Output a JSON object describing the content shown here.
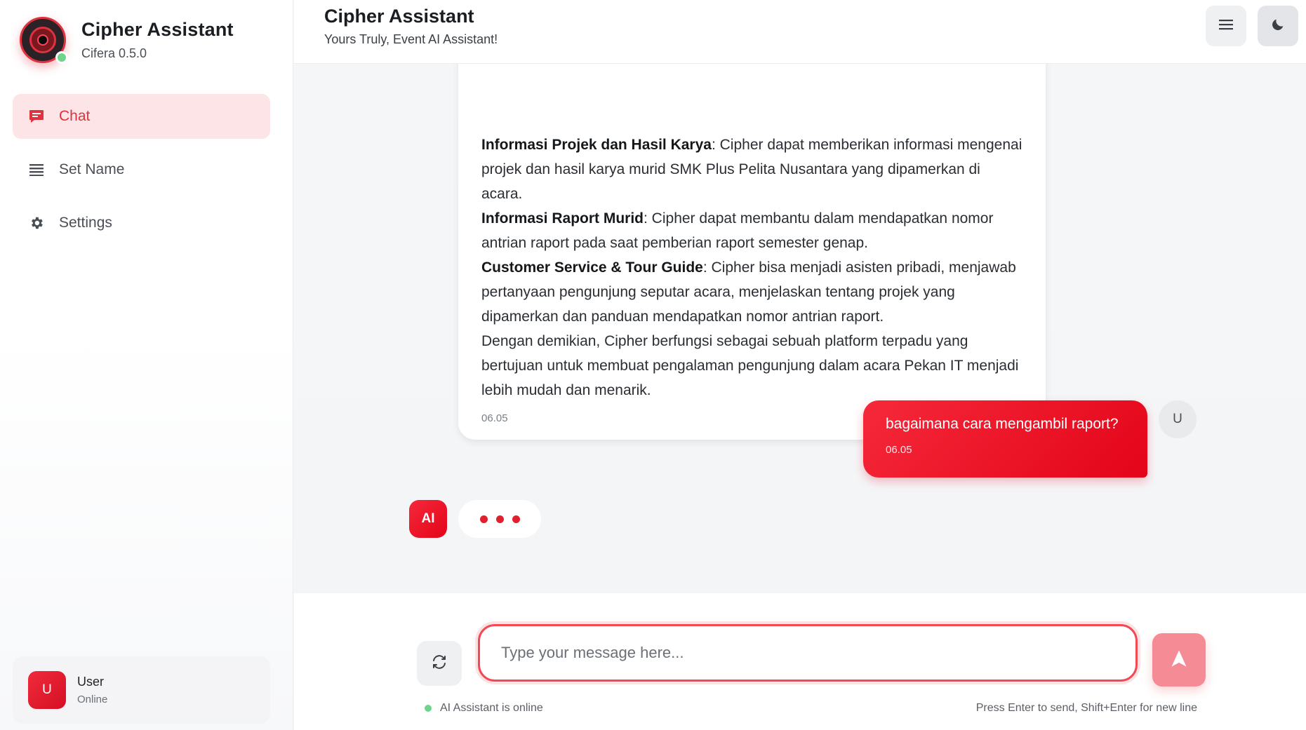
{
  "brand": {
    "title": "Cipher Assistant",
    "version": "Cifera 0.5.0"
  },
  "nav": [
    {
      "label": "Chat",
      "icon": "chat-icon",
      "active": true
    },
    {
      "label": "Set Name",
      "icon": "list-icon",
      "active": false
    },
    {
      "label": "Settings",
      "icon": "gear-icon",
      "active": false
    }
  ],
  "user": {
    "avatar": "U",
    "name": "User",
    "status": "Online"
  },
  "header": {
    "title": "Cipher Assistant",
    "subtitle": "Yours Truly, Event AI Assistant!",
    "menu_icon": "menu-icon",
    "theme_icon": "moon-icon"
  },
  "messages": {
    "ai_prev": {
      "p1_bold": "Informasi Projek dan Hasil Karya",
      "p1_text": ": Cipher dapat memberikan informasi mengenai projek dan hasil karya murid SMK Plus Pelita Nusantara yang dipamerkan di acara.",
      "p2_bold": "Informasi Raport Murid",
      "p2_text": ": Cipher dapat membantu dalam mendapatkan nomor antrian raport pada saat pemberian raport semester genap.",
      "p3_bold": "Customer Service & Tour Guide",
      "p3_text": ": Cipher bisa menjadi asisten pribadi, menjawab pertanyaan pengunjung seputar acara, menjelaskan tentang projek yang dipamerkan dan panduan mendapatkan nomor antrian raport.",
      "p4_text": "Dengan demikian, Cipher berfungsi sebagai sebuah platform terpadu yang bertujuan untuk membuat pengalaman pengunjung dalam acara Pekan IT menjadi lebih mudah dan menarik.",
      "time": "06.05"
    },
    "user_msg": {
      "text": "bagaimana cara mengambil raport?",
      "time": "06.05",
      "avatar": "U"
    },
    "ai_typing": {
      "avatar": "AI"
    }
  },
  "composer": {
    "placeholder": "Type your message here...",
    "value": "",
    "status": "AI Assistant is online",
    "hint": "Press Enter to send, Shift+Enter for new line"
  },
  "colors": {
    "accent": "#e40419",
    "accent_light": "#fde4e6",
    "online": "#6fd38a"
  }
}
